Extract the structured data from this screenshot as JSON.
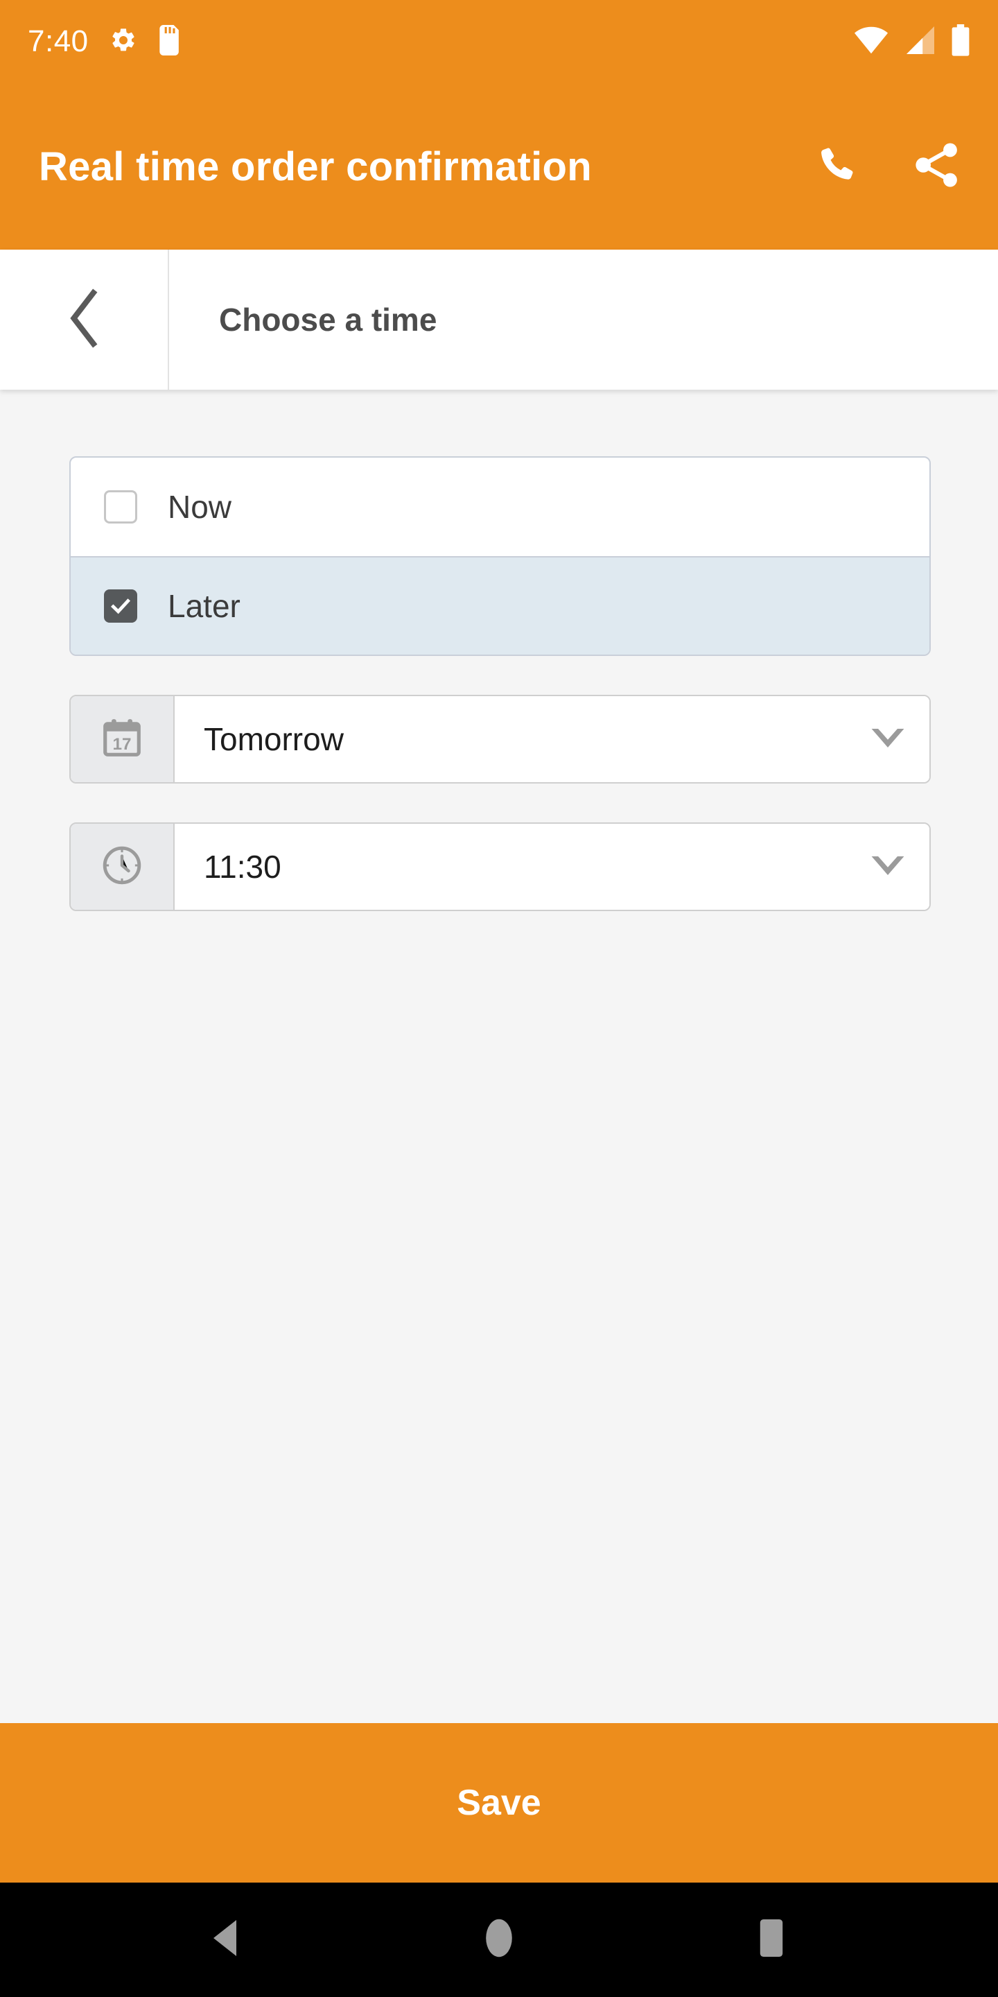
{
  "theme": {
    "accent": "#ed8d1c",
    "selected_row_bg": "#dfe9f0",
    "checkbox_checked_bg": "#56595b",
    "content_bg": "#f5f5f5",
    "nav_bar_bg": "#000000"
  },
  "status_bar": {
    "clock": "7:40",
    "icons_left": [
      "gear-icon",
      "sd-card-icon"
    ],
    "icons_right": [
      "wifi-icon",
      "cellular-signal-icon",
      "battery-icon"
    ]
  },
  "app_bar": {
    "title": "Real time order confirmation",
    "actions": [
      {
        "name": "phone-icon",
        "label": "Call"
      },
      {
        "name": "share-icon",
        "label": "Share"
      }
    ]
  },
  "sub_header": {
    "back_icon": "chevron-left-icon",
    "title": "Choose a time"
  },
  "options": {
    "items": [
      {
        "label": "Now",
        "checked": false
      },
      {
        "label": "Later",
        "checked": true
      }
    ]
  },
  "fields": {
    "date": {
      "icon": "calendar-icon",
      "icon_day": "17",
      "value": "Tomorrow",
      "caret": "chevron-down-icon"
    },
    "time": {
      "icon": "clock-icon",
      "value": "11:30",
      "caret": "chevron-down-icon"
    }
  },
  "footer": {
    "save_label": "Save"
  },
  "nav_bar": {
    "buttons": [
      {
        "name": "back-nav-icon",
        "label": "Back"
      },
      {
        "name": "home-nav-icon",
        "label": "Home"
      },
      {
        "name": "recents-nav-icon",
        "label": "Recents"
      }
    ]
  }
}
